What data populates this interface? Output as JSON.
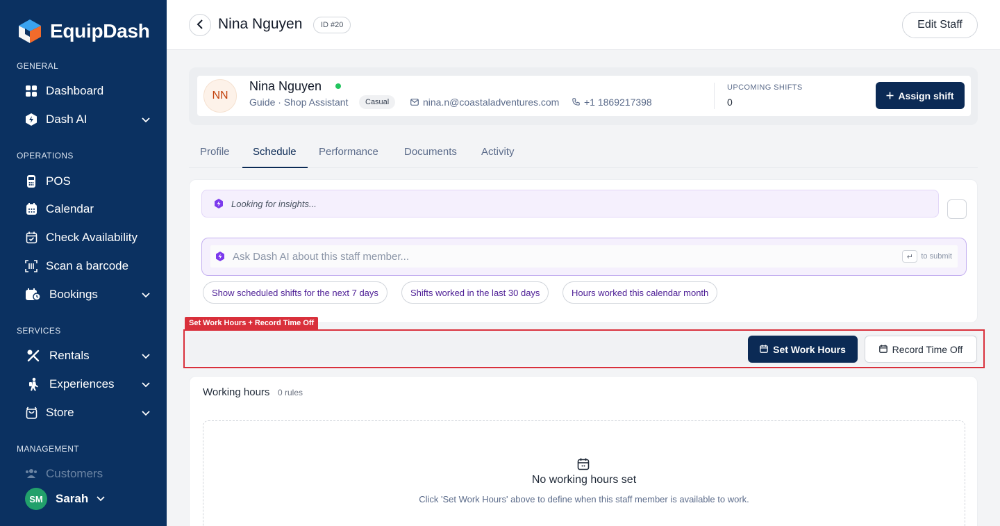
{
  "sidebar": {
    "brand": "EquipDash",
    "sections": {
      "general": "GENERAL",
      "operations": "OPERATIONS",
      "services": "SERVICES",
      "management": "MANAGEMENT"
    },
    "items": {
      "dashboard": "Dashboard",
      "dash_ai": "Dash AI",
      "pos": "POS",
      "calendar": "Calendar",
      "check_availability": "Check Availability",
      "scan_barcode": "Scan a barcode",
      "bookings": "Bookings",
      "rentals": "Rentals",
      "experiences": "Experiences",
      "store": "Store",
      "customers": "Customers"
    },
    "user": {
      "initials": "SM",
      "name": "Sarah"
    }
  },
  "header": {
    "title": "Nina Nguyen",
    "id_badge": "ID #20",
    "edit_button": "Edit Staff"
  },
  "profile": {
    "initials": "NN",
    "name": "Nina Nguyen",
    "role": "Guide · Shop Assistant",
    "employment_type": "Casual",
    "email": "nina.n@coastaladventures.com",
    "phone": "+1 1869217398",
    "upcoming_label": "UPCOMING SHIFTS",
    "upcoming_value": "0",
    "assign_button": "Assign shift",
    "online": true
  },
  "tabs": [
    "Profile",
    "Schedule",
    "Performance",
    "Documents",
    "Activity"
  ],
  "active_tab": "Schedule",
  "ai": {
    "insights_text": "Looking for insights...",
    "ask_placeholder": "Ask Dash AI about this staff member...",
    "submit_hint": "to submit",
    "chips": [
      "Show scheduled shifts for the next 7 days",
      "Shifts worked in the last 30 days",
      "Hours worked this calendar month"
    ]
  },
  "highlight_label": "Set Work Hours + Record Time Off",
  "actions": {
    "set_work_hours": "Set Work Hours",
    "record_time_off": "Record Time Off"
  },
  "working_hours": {
    "title": "Working hours",
    "count": "0 rules",
    "empty_title": "No working hours set",
    "empty_desc": "Click 'Set Work Hours' above to define when this staff member is available to work."
  },
  "colors": {
    "sidebar_bg": "#0b3161",
    "primary": "#0b2a55",
    "ai_accent": "#7c3aed",
    "highlight": "#d9303b",
    "online": "#22c55e"
  }
}
